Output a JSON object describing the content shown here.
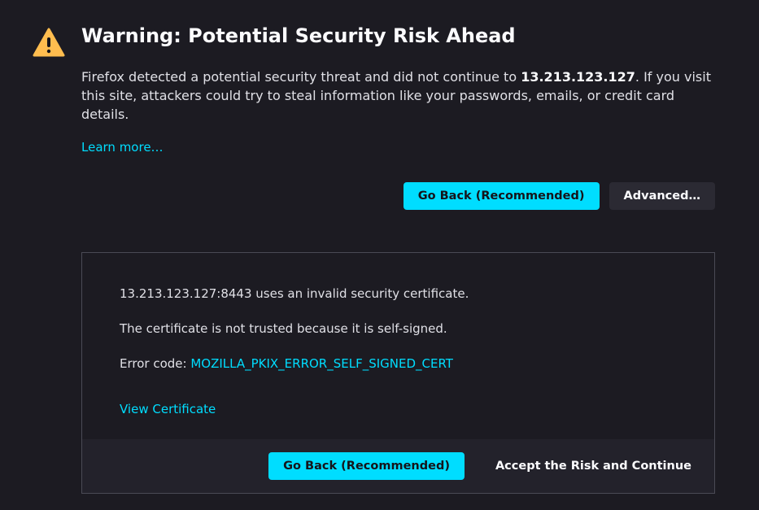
{
  "header": {
    "title": "Warning: Potential Security Risk Ahead"
  },
  "description": {
    "prefix": "Firefox detected a potential security threat and did not continue to ",
    "host": "13.213.123.127",
    "suffix": ". If you visit this site, attackers could try to steal information like your passwords, emails, or credit card details."
  },
  "learn_more": "Learn more…",
  "buttons": {
    "go_back": "Go Back (Recommended)",
    "advanced": "Advanced…"
  },
  "advanced": {
    "cert_invalid": "13.213.123.127:8443 uses an invalid security certificate.",
    "cert_reason": "The certificate is not trusted because it is self-signed.",
    "error_code_label": "Error code: ",
    "error_code": "MOZILLA_PKIX_ERROR_SELF_SIGNED_CERT",
    "view_certificate": "View Certificate",
    "footer": {
      "go_back": "Go Back (Recommended)",
      "accept": "Accept the Risk and Continue"
    }
  }
}
